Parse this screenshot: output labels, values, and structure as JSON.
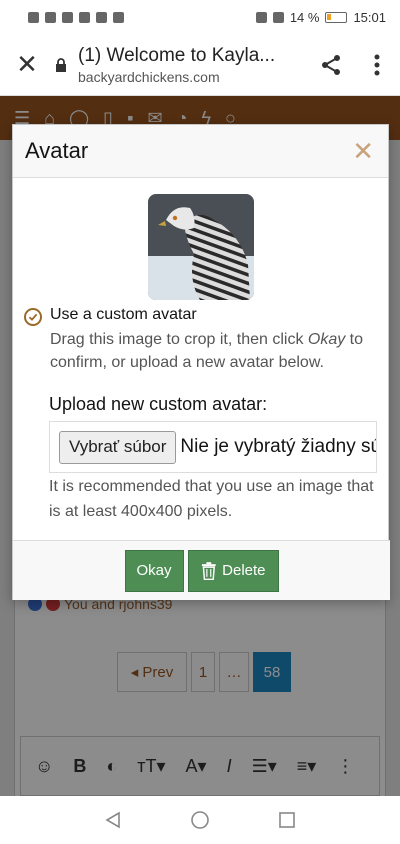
{
  "status": {
    "battery": "14 %",
    "time": "15:01"
  },
  "browser": {
    "title": "(1) Welcome to Kayla...",
    "domain": "backyardchickens.com"
  },
  "background": {
    "reactions_text": "You and rjohns39",
    "pager": {
      "prev": "Prev",
      "p1": "1",
      "ellipsis": "…",
      "current": "58"
    }
  },
  "modal": {
    "title": "Avatar",
    "radio_label": "Use a custom avatar",
    "radio_hint_pre": "Drag this image to crop it, then click ",
    "radio_hint_em": "Okay",
    "radio_hint_post": " to confirm, or upload a new avatar below.",
    "upload_label": "Upload new custom avatar:",
    "file_button": "Vybrať súbor",
    "file_status": "Nie je vybratý žiadny súbor",
    "upload_hint": "It is recommended that you use an image that is at least 400x400 pixels.",
    "okay_label": "Okay",
    "delete_label": "Delete"
  }
}
